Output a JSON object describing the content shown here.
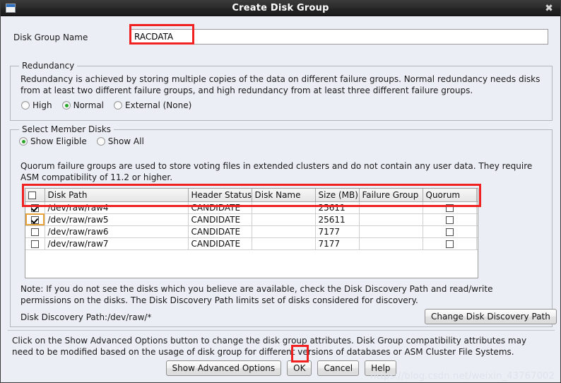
{
  "window": {
    "title": "Create Disk Group",
    "icon": "window-icon",
    "close_label": "✖"
  },
  "disk_group_name": {
    "label": "Disk Group Name",
    "value": "RACDATA",
    "placeholder": ""
  },
  "redundancy": {
    "legend": "Redundancy",
    "description": "Redundancy is achieved by storing multiple copies of the data on different failure groups. Normal redundancy needs disks from at least two different failure groups, and high redundancy from at least three different failure groups.",
    "options": [
      {
        "label": "High",
        "selected": false
      },
      {
        "label": "Normal",
        "selected": true
      },
      {
        "label": "External (None)",
        "selected": false
      }
    ]
  },
  "member_disks": {
    "legend": "Select Member Disks",
    "filter_options": [
      {
        "label": "Show Eligible",
        "selected": true
      },
      {
        "label": "Show All",
        "selected": false
      }
    ],
    "quorum_note": "Quorum failure groups are used to store voting files in extended clusters and do not contain any user data. They require ASM compatibility of 11.2 or higher.",
    "columns": [
      "",
      "Disk Path",
      "Header Status",
      "Disk Name",
      "Size (MB)",
      "Failure Group",
      "Quorum",
      ""
    ],
    "header_select_all": false,
    "rows": [
      {
        "selected": true,
        "disk_path": "/dev/raw/raw4",
        "header_status": "CANDIDATE",
        "disk_name": "",
        "size_mb": "25611",
        "failure_group": "",
        "quorum": false,
        "focused": false
      },
      {
        "selected": true,
        "disk_path": "/dev/raw/raw5",
        "header_status": "CANDIDATE",
        "disk_name": "",
        "size_mb": "25611",
        "failure_group": "",
        "quorum": false,
        "focused": true
      },
      {
        "selected": false,
        "disk_path": "/dev/raw/raw6",
        "header_status": "CANDIDATE",
        "disk_name": "",
        "size_mb": "7177",
        "failure_group": "",
        "quorum": false,
        "focused": false
      },
      {
        "selected": false,
        "disk_path": "/dev/raw/raw7",
        "header_status": "CANDIDATE",
        "disk_name": "",
        "size_mb": "7177",
        "failure_group": "",
        "quorum": false,
        "focused": false
      }
    ],
    "note": "Note: If you do not see the disks which you believe are available, check the Disk Discovery Path and read/write permissions on the disks. The Disk Discovery Path limits set of disks considered for discovery.",
    "discovery_path": "Disk Discovery Path:/dev/raw/*",
    "change_path_button": "Change Disk Discovery Path"
  },
  "footer": {
    "hint": "Click on the Show Advanced Options button to change the disk group attributes. Disk Group compatibility attributes may need to be modified based on the usage of disk group for different versions of databases or ASM Cluster File Systems.",
    "buttons": [
      {
        "label": "Show Advanced Options",
        "highlighted": false
      },
      {
        "label": "OK",
        "highlighted": true
      },
      {
        "label": "Cancel",
        "highlighted": false
      },
      {
        "label": "Help",
        "highlighted": false
      }
    ]
  },
  "watermark": "https://blog.csdn.net/weixin_43767002",
  "colors": {
    "dialog_background": "#eceef5",
    "titlebar": "#2c2c2c",
    "annotation_red": "#f22121",
    "radio_selected": "#27a727",
    "focus_outline": "#e8a33d"
  }
}
